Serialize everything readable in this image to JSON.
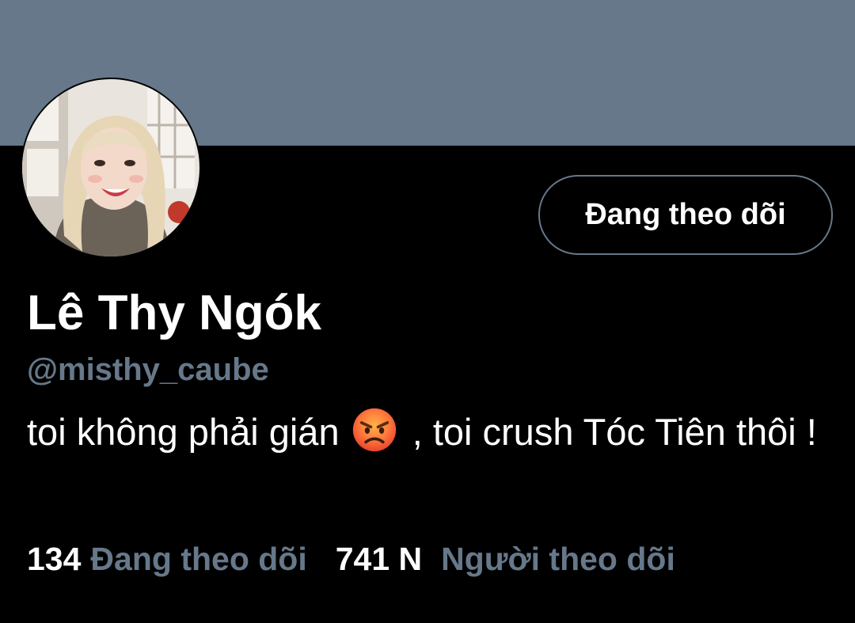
{
  "colors": {
    "banner": "#66788a",
    "background": "#000000",
    "text_primary": "#ffffff",
    "text_secondary": "#66788a"
  },
  "profile": {
    "avatar_icon": "profile-photo",
    "display_name": "Lê Thy Ngók",
    "handle": "@misthy_caube",
    "follow_button_label": "Đang theo dõi",
    "bio": {
      "part1": "toi không phải gián",
      "emoji_icon": "angry-face-emoji",
      "part2": ", toi crush Tóc Tiên thôi !"
    },
    "stats": {
      "following_count": "134",
      "following_label": "Đang theo dõi",
      "followers_count": "741 N",
      "followers_label": "Người theo dõi"
    }
  }
}
